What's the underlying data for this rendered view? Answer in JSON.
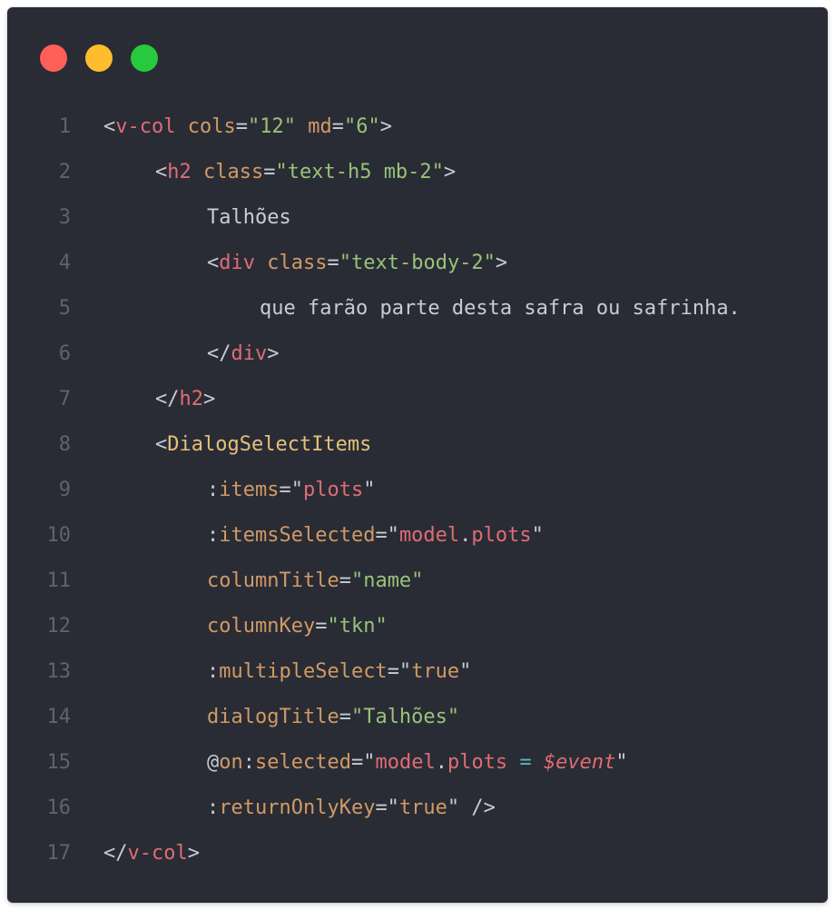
{
  "window": {
    "controls": {
      "close_color": "#ff5f56",
      "minimize_color": "#ffbd2e",
      "maximize_color": "#27c93f"
    }
  },
  "code": {
    "lines": [
      {
        "n": "1",
        "tokens": [
          "<",
          "v-col",
          " ",
          "cols",
          "=",
          "\"12\"",
          " ",
          "md",
          "=",
          "\"6\"",
          ">"
        ]
      },
      {
        "n": "2",
        "tokens": [
          "<",
          "h2",
          " ",
          "class",
          "=",
          "\"text-h5 mb-2\"",
          ">"
        ]
      },
      {
        "n": "3",
        "tokens": [
          "Talhões"
        ]
      },
      {
        "n": "4",
        "tokens": [
          "<",
          "div",
          " ",
          "class",
          "=",
          "\"text-body-2\"",
          ">"
        ]
      },
      {
        "n": "5",
        "tokens": [
          "que farão parte desta safra ou safrinha."
        ]
      },
      {
        "n": "6",
        "tokens": [
          "</",
          "div",
          ">"
        ]
      },
      {
        "n": "7",
        "tokens": [
          "</",
          "h2",
          ">"
        ]
      },
      {
        "n": "8",
        "tokens": [
          "<",
          "DialogSelectItems"
        ]
      },
      {
        "n": "9",
        "tokens": [
          ":",
          "items",
          "=\"",
          "plots",
          "\""
        ]
      },
      {
        "n": "10",
        "tokens": [
          ":",
          "itemsSelected",
          "=\"",
          "model",
          ".",
          "plots",
          "\""
        ]
      },
      {
        "n": "11",
        "tokens": [
          "columnTitle",
          "=",
          "\"name\""
        ]
      },
      {
        "n": "12",
        "tokens": [
          "columnKey",
          "=",
          "\"tkn\""
        ]
      },
      {
        "n": "13",
        "tokens": [
          ":",
          "multipleSelect",
          "=\"",
          "true",
          "\""
        ]
      },
      {
        "n": "14",
        "tokens": [
          "dialogTitle",
          "=",
          "\"Talhões\""
        ]
      },
      {
        "n": "15",
        "tokens": [
          "@",
          "on",
          ":",
          "selected",
          "=\"",
          "model",
          ".",
          "plots",
          " ",
          "=",
          " ",
          "$event",
          "\""
        ]
      },
      {
        "n": "16",
        "tokens": [
          ":",
          "returnOnlyKey",
          "=\"",
          "true",
          "\"",
          " />"
        ]
      },
      {
        "n": "17",
        "tokens": [
          "</",
          "v-col",
          ">"
        ]
      }
    ]
  },
  "colors": {
    "background": "#292c34",
    "line_number": "#5e6370",
    "tag": "#e06c75",
    "attribute": "#d19a66",
    "string": "#98c379",
    "component": "#e5c07b",
    "operator": "#56b6c2",
    "text": "#c8ccd4"
  }
}
